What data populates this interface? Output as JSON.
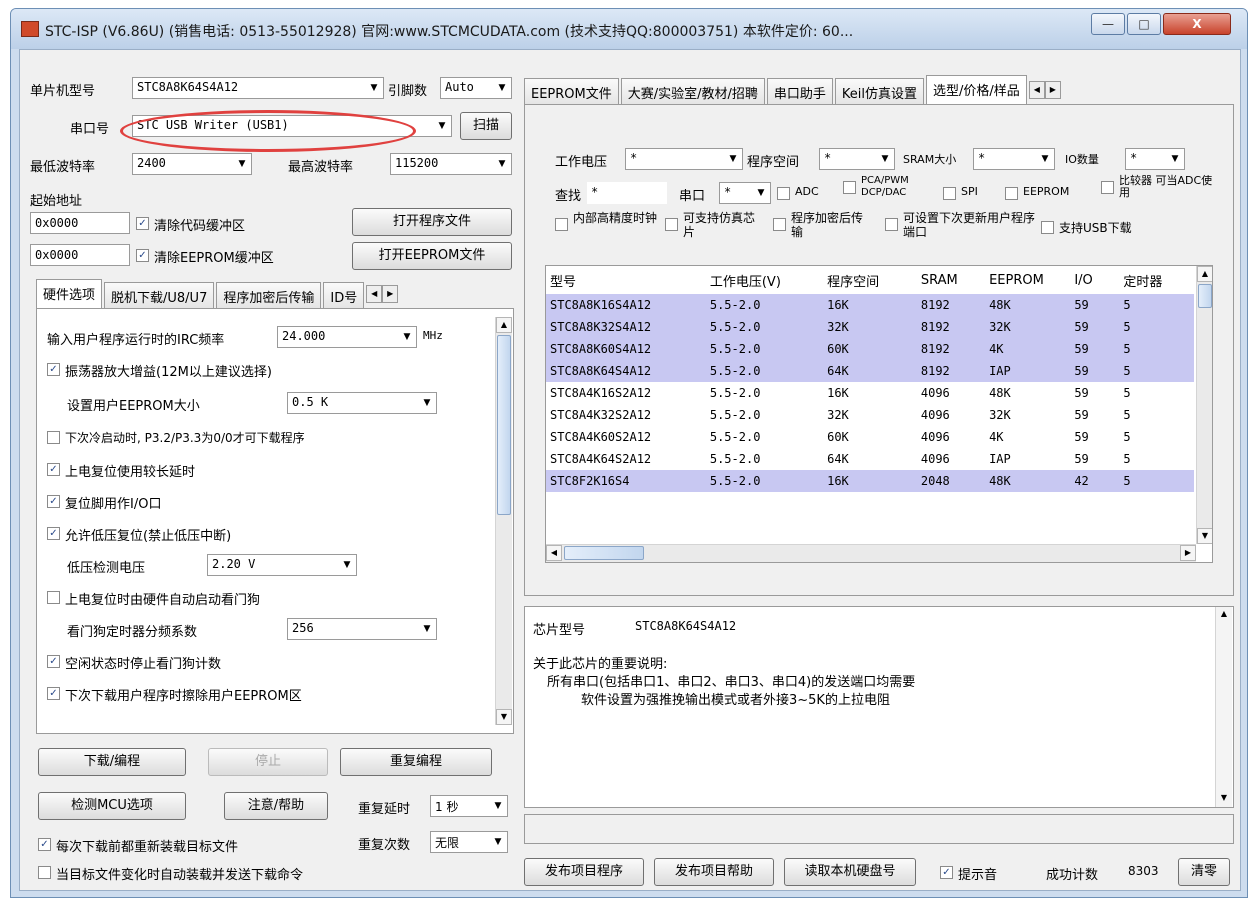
{
  "window": {
    "title": "STC-ISP (V6.86U) (销售电话: 0513-55012928) 官网:www.STCMCUDATA.com (技术支持QQ:800003751) 本软件定价: 60...",
    "min": "—",
    "max": "□",
    "close": "X"
  },
  "left": {
    "mcu_type_label": "单片机型号",
    "mcu_type_value": "STC8A8K64S4A12",
    "pins_label": "引脚数",
    "pins_value": "Auto",
    "port_label": "串口号",
    "port_value": "STC USB Writer (USB1)",
    "scan_button": "扫描",
    "min_baud_label": "最低波特率",
    "min_baud_value": "2400",
    "max_baud_label": "最高波特率",
    "max_baud_value": "115200",
    "start_addr_label": "起始地址",
    "addr1": "0x0000",
    "clear_code_label": "清除代码缓冲区",
    "open_prog_button": "打开程序文件",
    "addr2": "0x0000",
    "clear_eeprom_label": "清除EEPROM缓冲区",
    "open_eeprom_button": "打开EEPROM文件",
    "tabs": [
      "硬件选项",
      "脱机下载/U8/U7",
      "程序加密后传输",
      "ID号"
    ],
    "options": {
      "irc_label": "输入用户程序运行时的IRC频率",
      "irc_value": "24.000",
      "irc_unit": "MHz",
      "osc_gain": "振荡器放大增益(12M以上建议选择)",
      "eeprom_size_label": "设置用户EEPROM大小",
      "eeprom_size_value": "0.5 K",
      "cold_boot": "下次冷启动时, P3.2/P3.3为0/0才可下载程序",
      "long_reset": "上电复位使用较长延时",
      "reset_io": "复位脚用作I/O口",
      "low_volt_reset": "允许低压复位(禁止低压中断)",
      "low_volt_label": "低压检测电压",
      "low_volt_value": "2.20 V",
      "wdt_auto": "上电复位时由硬件自动启动看门狗",
      "wdt_div_label": "看门狗定时器分频系数",
      "wdt_div_value": "256",
      "idle_wdt": "空闲状态时停止看门狗计数",
      "clear_eeprom": "下次下载用户程序时擦除用户EEPROM区"
    },
    "download_button": "下载/编程",
    "stop_button": "停止",
    "reprogram_button": "重复编程",
    "check_mcu_button": "检测MCU选项",
    "help_button": "注意/帮助",
    "repeat_delay_label": "重复延时",
    "repeat_delay_value": "1 秒",
    "repeat_count_label": "重复次数",
    "repeat_count_value": "无限",
    "reload_label": "每次下载前都重新装载目标文件",
    "auto_send_label": "当目标文件变化时自动装载并发送下载命令"
  },
  "right": {
    "tabs": [
      "EEPROM文件",
      "大赛/实验室/教材/招聘",
      "串口助手",
      "Keil仿真设置",
      "选型/价格/样品"
    ],
    "filter": {
      "voltage_label": "工作电压",
      "voltage_value": "*",
      "flash_label": "程序空间",
      "flash_value": "*",
      "sram_label": "SRAM大小",
      "sram_value": "*",
      "io_label": "IO数量",
      "io_value": "*",
      "search_label": "查找",
      "search_value": "*",
      "uart_label": "串口",
      "uart_value": "*",
      "adc": "ADC",
      "pca": "PCA/PWM DCP/DAC",
      "spi": "SPI",
      "eeprom": "EEPROM",
      "comp": "比较器 可当ADC使用",
      "internal_osc": "内部高精度时钟",
      "sim": "可支持仿真芯片",
      "encrypt": "程序加密后传输",
      "user_prog": "可设置下次更新用户程序端口",
      "usb": "支持USB下载"
    },
    "table": {
      "headers": [
        "型号",
        "工作电压(V)",
        "程序空间",
        "SRAM",
        "EEPROM",
        "I/O",
        "定时器"
      ],
      "rows": [
        {
          "sel": true,
          "cells": [
            "STC8A8K16S4A12",
            "5.5-2.0",
            "16K",
            "8192",
            "48K",
            "59",
            "5"
          ]
        },
        {
          "sel": true,
          "cells": [
            "STC8A8K32S4A12",
            "5.5-2.0",
            "32K",
            "8192",
            "32K",
            "59",
            "5"
          ]
        },
        {
          "sel": true,
          "cells": [
            "STC8A8K60S4A12",
            "5.5-2.0",
            "60K",
            "8192",
            "4K",
            "59",
            "5"
          ]
        },
        {
          "sel": true,
          "cells": [
            "STC8A8K64S4A12",
            "5.5-2.0",
            "64K",
            "8192",
            "IAP",
            "59",
            "5"
          ]
        },
        {
          "sel": false,
          "cells": [
            "STC8A4K16S2A12",
            "5.5-2.0",
            "16K",
            "4096",
            "48K",
            "59",
            "5"
          ]
        },
        {
          "sel": false,
          "cells": [
            "STC8A4K32S2A12",
            "5.5-2.0",
            "32K",
            "4096",
            "32K",
            "59",
            "5"
          ]
        },
        {
          "sel": false,
          "cells": [
            "STC8A4K60S2A12",
            "5.5-2.0",
            "60K",
            "4096",
            "4K",
            "59",
            "5"
          ]
        },
        {
          "sel": false,
          "cells": [
            "STC8A4K64S2A12",
            "5.5-2.0",
            "64K",
            "4096",
            "IAP",
            "59",
            "5"
          ]
        },
        {
          "sel": true,
          "cells": [
            "STC8F2K16S4",
            "5.5-2.0",
            "16K",
            "2048",
            "48K",
            "42",
            "5"
          ]
        }
      ]
    },
    "info": {
      "chip_label": "芯片型号",
      "chip_value": "STC8A8K64S4A12",
      "note_title": "关于此芯片的重要说明:",
      "note_line1": "所有串口(包括串口1、串口2、串口3、串口4)的发送端口均需要",
      "note_line2": "软件设置为强推挽输出模式或者外接3~5K的上拉电阻"
    },
    "publish_button": "发布项目程序",
    "publish_help_button": "发布项目帮助",
    "read_id_button": "读取本机硬盘号",
    "sound_label": "提示音",
    "success_label": "成功计数",
    "success_count": "8303",
    "clear_button": "清零"
  }
}
